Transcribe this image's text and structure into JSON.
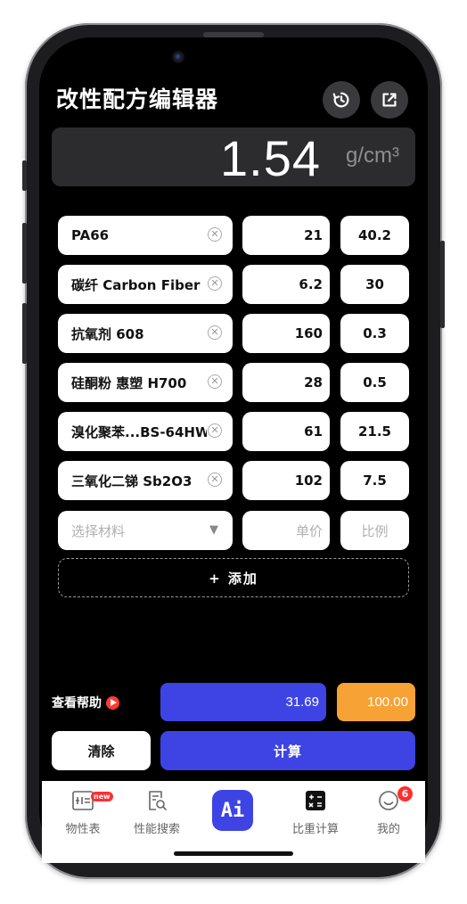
{
  "header": {
    "title": "改性配方编辑器"
  },
  "display": {
    "value": "1.54",
    "unit": "g/cm³"
  },
  "rows": [
    {
      "name": "PA66",
      "price": "21",
      "ratio": "40.2"
    },
    {
      "name": "碳纤 Carbon Fiber",
      "price": "6.2",
      "ratio": "30"
    },
    {
      "name": "抗氧剂 608",
      "price": "160",
      "ratio": "0.3"
    },
    {
      "name": "硅酮粉 惠塑 H700",
      "price": "28",
      "ratio": "0.5"
    },
    {
      "name": "溴化聚苯...BS-64HW",
      "price": "61",
      "ratio": "21.5"
    },
    {
      "name": "三氧化二锑 Sb2O3",
      "price": "102",
      "ratio": "7.5"
    }
  ],
  "new_row": {
    "material_placeholder": "选择材料",
    "price_placeholder": "单价",
    "ratio_placeholder": "比例"
  },
  "add_button": "+ 添加",
  "summary": {
    "help_label": "查看帮助",
    "total_price": "31.69",
    "total_ratio": "100.00"
  },
  "actions": {
    "clear_label": "清除",
    "calculate_label": "计算"
  },
  "tabs": [
    {
      "label": "物性表",
      "icon": "property-table-icon",
      "badge": "new"
    },
    {
      "label": "性能搜索",
      "icon": "document-search-icon"
    },
    {
      "label": "Ai",
      "icon": "ai-icon"
    },
    {
      "label": "比重计算",
      "icon": "calculator-icon",
      "active": true
    },
    {
      "label": "我的",
      "icon": "smile-profile-icon",
      "badge": "6"
    }
  ],
  "colors": {
    "accent": "#3e44e4",
    "orange": "#f7a234",
    "badge": "#ff2d2d",
    "background": "#000000"
  }
}
